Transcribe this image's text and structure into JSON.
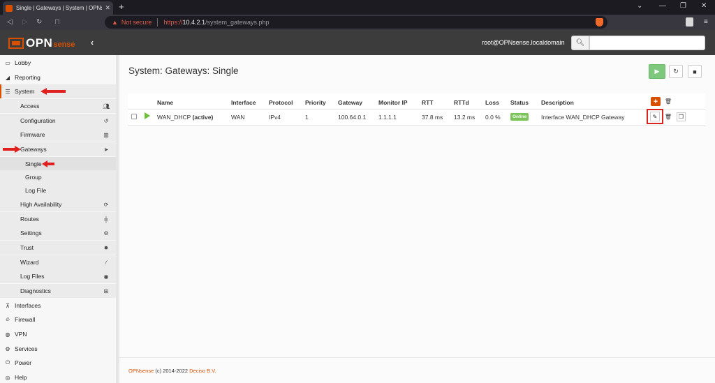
{
  "browser": {
    "tab_title": "Single | Gateways | System | OPNs",
    "tab_close": "✕",
    "new_tab": "+",
    "not_secure": "Not secure",
    "url_scheme": "https://",
    "url_host": "10.4.2.1",
    "url_path": "/system_gateways.php"
  },
  "header": {
    "logo_text": "OPN",
    "logo_text2": "sense",
    "user": "root@OPNsense.localdomain",
    "search_placeholder": ""
  },
  "sidebar": {
    "lobby": "Lobby",
    "reporting": "Reporting",
    "system": "System",
    "access": "Access",
    "configuration": "Configuration",
    "firmware": "Firmware",
    "gateways": "Gateways",
    "single": "Single",
    "group": "Group",
    "log_file": "Log File",
    "high_availability": "High Availability",
    "routes": "Routes",
    "settings": "Settings",
    "trust": "Trust",
    "wizard": "Wizard",
    "log_files": "Log Files",
    "diagnostics": "Diagnostics",
    "interfaces": "Interfaces",
    "firewall": "Firewall",
    "vpn": "VPN",
    "services": "Services",
    "power": "Power",
    "help": "Help"
  },
  "main": {
    "title": "System: Gateways: Single",
    "columns": {
      "name": "Name",
      "interface": "Interface",
      "protocol": "Protocol",
      "priority": "Priority",
      "gateway": "Gateway",
      "monitor_ip": "Monitor IP",
      "rtt": "RTT",
      "rttd": "RTTd",
      "loss": "Loss",
      "status": "Status",
      "description": "Description"
    },
    "row": {
      "name": "WAN_DHCP",
      "name_suffix": "(active)",
      "interface": "WAN",
      "protocol": "IPv4",
      "priority": "1",
      "gateway": "100.64.0.1",
      "monitor_ip": "1.1.1.1",
      "rtt": "37.8 ms",
      "rttd": "13.2 ms",
      "loss": "0.0 %",
      "status": "Online",
      "description": "Interface WAN_DHCP Gateway"
    }
  },
  "footer": {
    "brand": "OPNsense",
    "copyright": " (c) 2014-2022 ",
    "company": "Deciso B.V."
  },
  "colors": {
    "accent": "#d94f00",
    "online": "#7cc35a",
    "annotation_red": "#e0201e"
  }
}
